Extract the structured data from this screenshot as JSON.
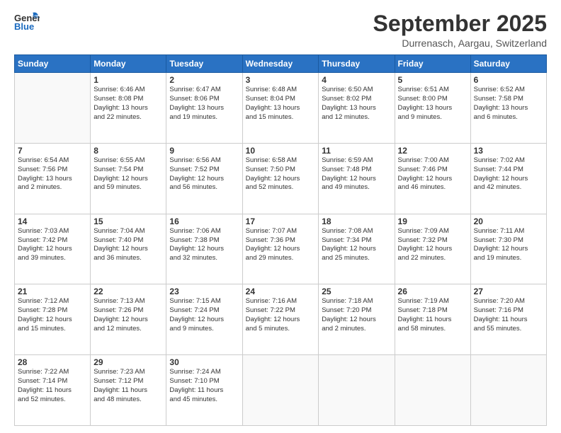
{
  "header": {
    "logo_general": "General",
    "logo_blue": "Blue",
    "month_title": "September 2025",
    "location": "Durrenasch, Aargau, Switzerland"
  },
  "weekdays": [
    "Sunday",
    "Monday",
    "Tuesday",
    "Wednesday",
    "Thursday",
    "Friday",
    "Saturday"
  ],
  "weeks": [
    [
      {
        "day": "",
        "info": ""
      },
      {
        "day": "1",
        "info": "Sunrise: 6:46 AM\nSunset: 8:08 PM\nDaylight: 13 hours\nand 22 minutes."
      },
      {
        "day": "2",
        "info": "Sunrise: 6:47 AM\nSunset: 8:06 PM\nDaylight: 13 hours\nand 19 minutes."
      },
      {
        "day": "3",
        "info": "Sunrise: 6:48 AM\nSunset: 8:04 PM\nDaylight: 13 hours\nand 15 minutes."
      },
      {
        "day": "4",
        "info": "Sunrise: 6:50 AM\nSunset: 8:02 PM\nDaylight: 13 hours\nand 12 minutes."
      },
      {
        "day": "5",
        "info": "Sunrise: 6:51 AM\nSunset: 8:00 PM\nDaylight: 13 hours\nand 9 minutes."
      },
      {
        "day": "6",
        "info": "Sunrise: 6:52 AM\nSunset: 7:58 PM\nDaylight: 13 hours\nand 6 minutes."
      }
    ],
    [
      {
        "day": "7",
        "info": "Sunrise: 6:54 AM\nSunset: 7:56 PM\nDaylight: 13 hours\nand 2 minutes."
      },
      {
        "day": "8",
        "info": "Sunrise: 6:55 AM\nSunset: 7:54 PM\nDaylight: 12 hours\nand 59 minutes."
      },
      {
        "day": "9",
        "info": "Sunrise: 6:56 AM\nSunset: 7:52 PM\nDaylight: 12 hours\nand 56 minutes."
      },
      {
        "day": "10",
        "info": "Sunrise: 6:58 AM\nSunset: 7:50 PM\nDaylight: 12 hours\nand 52 minutes."
      },
      {
        "day": "11",
        "info": "Sunrise: 6:59 AM\nSunset: 7:48 PM\nDaylight: 12 hours\nand 49 minutes."
      },
      {
        "day": "12",
        "info": "Sunrise: 7:00 AM\nSunset: 7:46 PM\nDaylight: 12 hours\nand 46 minutes."
      },
      {
        "day": "13",
        "info": "Sunrise: 7:02 AM\nSunset: 7:44 PM\nDaylight: 12 hours\nand 42 minutes."
      }
    ],
    [
      {
        "day": "14",
        "info": "Sunrise: 7:03 AM\nSunset: 7:42 PM\nDaylight: 12 hours\nand 39 minutes."
      },
      {
        "day": "15",
        "info": "Sunrise: 7:04 AM\nSunset: 7:40 PM\nDaylight: 12 hours\nand 36 minutes."
      },
      {
        "day": "16",
        "info": "Sunrise: 7:06 AM\nSunset: 7:38 PM\nDaylight: 12 hours\nand 32 minutes."
      },
      {
        "day": "17",
        "info": "Sunrise: 7:07 AM\nSunset: 7:36 PM\nDaylight: 12 hours\nand 29 minutes."
      },
      {
        "day": "18",
        "info": "Sunrise: 7:08 AM\nSunset: 7:34 PM\nDaylight: 12 hours\nand 25 minutes."
      },
      {
        "day": "19",
        "info": "Sunrise: 7:09 AM\nSunset: 7:32 PM\nDaylight: 12 hours\nand 22 minutes."
      },
      {
        "day": "20",
        "info": "Sunrise: 7:11 AM\nSunset: 7:30 PM\nDaylight: 12 hours\nand 19 minutes."
      }
    ],
    [
      {
        "day": "21",
        "info": "Sunrise: 7:12 AM\nSunset: 7:28 PM\nDaylight: 12 hours\nand 15 minutes."
      },
      {
        "day": "22",
        "info": "Sunrise: 7:13 AM\nSunset: 7:26 PM\nDaylight: 12 hours\nand 12 minutes."
      },
      {
        "day": "23",
        "info": "Sunrise: 7:15 AM\nSunset: 7:24 PM\nDaylight: 12 hours\nand 9 minutes."
      },
      {
        "day": "24",
        "info": "Sunrise: 7:16 AM\nSunset: 7:22 PM\nDaylight: 12 hours\nand 5 minutes."
      },
      {
        "day": "25",
        "info": "Sunrise: 7:18 AM\nSunset: 7:20 PM\nDaylight: 12 hours\nand 2 minutes."
      },
      {
        "day": "26",
        "info": "Sunrise: 7:19 AM\nSunset: 7:18 PM\nDaylight: 11 hours\nand 58 minutes."
      },
      {
        "day": "27",
        "info": "Sunrise: 7:20 AM\nSunset: 7:16 PM\nDaylight: 11 hours\nand 55 minutes."
      }
    ],
    [
      {
        "day": "28",
        "info": "Sunrise: 7:22 AM\nSunset: 7:14 PM\nDaylight: 11 hours\nand 52 minutes."
      },
      {
        "day": "29",
        "info": "Sunrise: 7:23 AM\nSunset: 7:12 PM\nDaylight: 11 hours\nand 48 minutes."
      },
      {
        "day": "30",
        "info": "Sunrise: 7:24 AM\nSunset: 7:10 PM\nDaylight: 11 hours\nand 45 minutes."
      },
      {
        "day": "",
        "info": ""
      },
      {
        "day": "",
        "info": ""
      },
      {
        "day": "",
        "info": ""
      },
      {
        "day": "",
        "info": ""
      }
    ]
  ]
}
